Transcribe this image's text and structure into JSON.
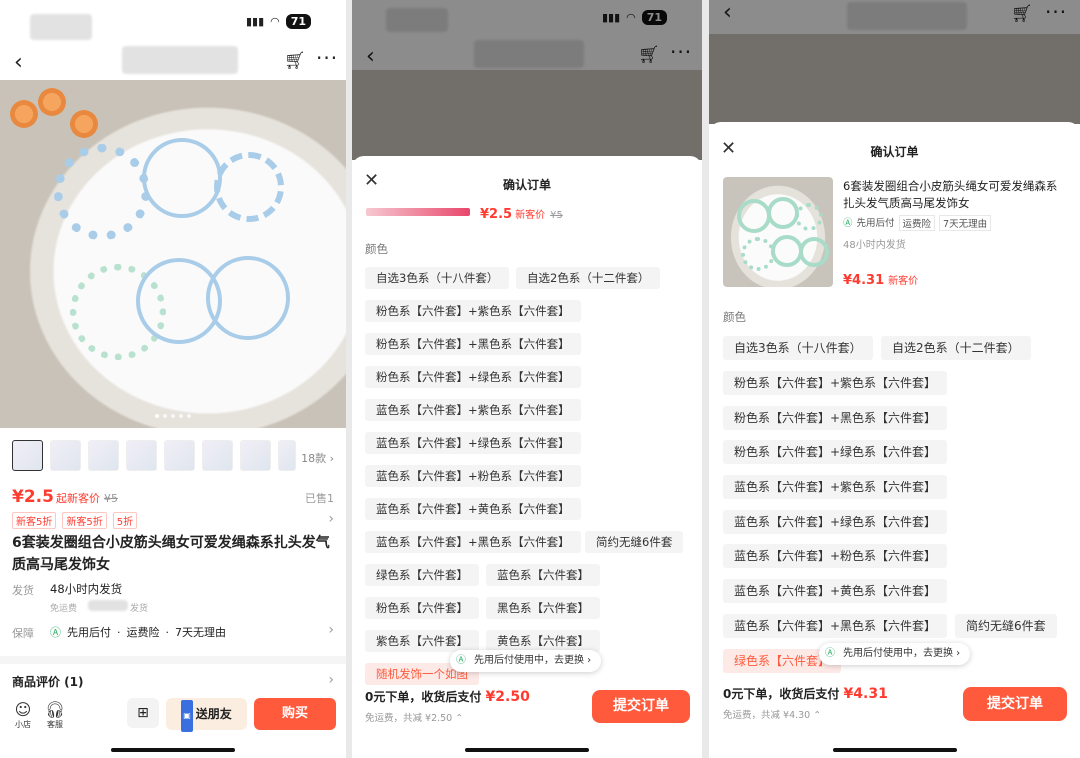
{
  "status": {
    "battery": "71"
  },
  "screen1": {
    "thumbs_more": "18款 ›",
    "price": "¥2.5",
    "price_tag": "起新客价",
    "price_orig": "¥5",
    "sold": "已售1",
    "coupons": [
      "新客5折",
      "新客5折",
      "5折"
    ],
    "title": "6套装发圈组合小皮筋头绳女可爱发绳森系扎头发气质高马尾发饰女",
    "ship_label": "发货",
    "ship_value": "48小时内发货",
    "ship_sub": "免运费",
    "ship_sub2": "发货",
    "guarantee_label": "保障",
    "guarantee": [
      "先用后付",
      "运费险",
      "7天无理由"
    ],
    "review": "商品评价 (1)",
    "bottom": {
      "shop": "小店",
      "service": "客服",
      "friend": "送朋友",
      "buy": "购买"
    }
  },
  "screen2": {
    "title": "确认订单",
    "price": "¥2.5",
    "price_tag": "新客价",
    "price_orig": "¥5",
    "color_label": "颜色",
    "options": [
      "自选3色系（十八件套）",
      "自选2色系（十二件套）",
      "粉色系【六件套】+紫色系【六件套】",
      "粉色系【六件套】+黑色系【六件套】",
      "粉色系【六件套】+绿色系【六件套】",
      "蓝色系【六件套】+紫色系【六件套】",
      "蓝色系【六件套】+绿色系【六件套】",
      "蓝色系【六件套】+粉色系【六件套】",
      "蓝色系【六件套】+黄色系【六件套】",
      "蓝色系【六件套】+黑色系【六件套】",
      "简约无缝6件套",
      "绿色系【六件套】",
      "蓝色系【六件套】",
      "粉色系【六件套】",
      "黑色系【六件套】",
      "紫色系【六件套】",
      "黄色系【六件套】",
      "随机发饰一个如图"
    ],
    "toast": "先用后付使用中，去更换 ›",
    "summary": "0元下单，收货后支付 ",
    "summary_price": "¥2.50",
    "summary_sub": "免运费，共减 ¥2.50 ⌃",
    "submit": "提交订单"
  },
  "screen3": {
    "title": "确认订单",
    "product_title": "6套装发圈组合小皮筋头绳女可爱发绳森系扎头发气质高马尾发饰女",
    "tags": [
      "先用后付",
      "运费险",
      "7天无理由"
    ],
    "ship": "48小时内发货",
    "price": "¥4.31",
    "price_tag": "新客价",
    "color_label": "颜色",
    "options": [
      "自选3色系（十八件套）",
      "自选2色系（十二件套）",
      "粉色系【六件套】+紫色系【六件套】",
      "粉色系【六件套】+黑色系【六件套】",
      "粉色系【六件套】+绿色系【六件套】",
      "蓝色系【六件套】+紫色系【六件套】",
      "蓝色系【六件套】+绿色系【六件套】",
      "蓝色系【六件套】+粉色系【六件套】",
      "蓝色系【六件套】+黄色系【六件套】",
      "蓝色系【六件套】+黑色系【六件套】",
      "简约无缝6件套",
      "绿色系【六件套】"
    ],
    "toast": "先用后付使用中，去更换 ›",
    "summary": "0元下单，收货后支付 ",
    "summary_price": "¥4.31",
    "summary_sub": "免运费，共减 ¥4.30 ⌃",
    "submit": "提交订单"
  },
  "colors": {
    "accent": "#ff5a3c",
    "price": "#ff3b30",
    "green": "#2fb06a"
  }
}
